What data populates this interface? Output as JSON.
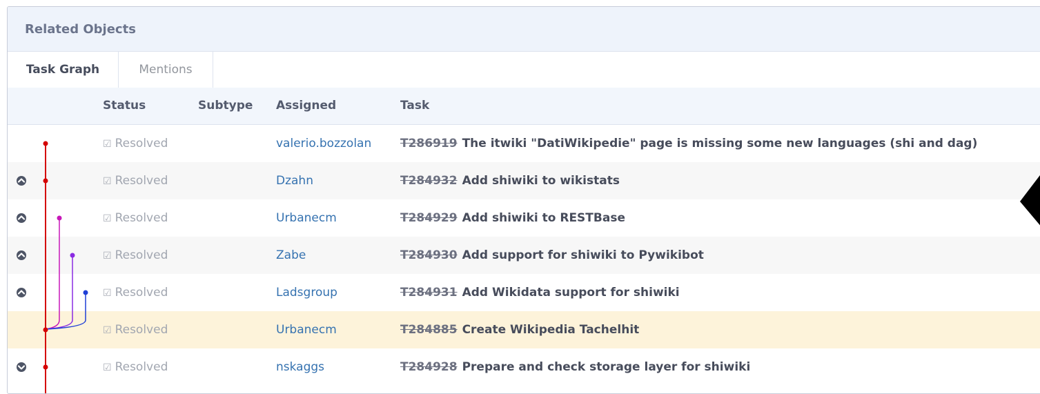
{
  "panel": {
    "title": "Related Objects"
  },
  "tabs": [
    {
      "label": "Task Graph",
      "active": true
    },
    {
      "label": "Mentions",
      "active": false
    }
  ],
  "columns": {
    "status": "Status",
    "subtype": "Subtype",
    "assigned": "Assigned",
    "task": "Task"
  },
  "rows": [
    {
      "toggle": "none",
      "status": "Resolved",
      "assigned": "valerio.bozzolan",
      "task_id": "T286919",
      "task_title": "The itwiki \"DatiWikipedie\" page is missing some new languages (shi and dag)"
    },
    {
      "toggle": "up",
      "status": "Resolved",
      "assigned": "Dzahn",
      "task_id": "T284932",
      "task_title": "Add shiwiki to wikistats"
    },
    {
      "toggle": "up",
      "status": "Resolved",
      "assigned": "Urbanecm",
      "task_id": "T284929",
      "task_title": "Add shiwiki to RESTBase"
    },
    {
      "toggle": "up",
      "status": "Resolved",
      "assigned": "Zabe",
      "task_id": "T284930",
      "task_title": "Add support for shiwiki to Pywikibot"
    },
    {
      "toggle": "up",
      "status": "Resolved",
      "assigned": "Ladsgroup",
      "task_id": "T284931",
      "task_title": "Add Wikidata support for shiwiki"
    },
    {
      "toggle": "none",
      "status": "Resolved",
      "assigned": "Urbanecm",
      "task_id": "T284885",
      "task_title": "Create Wikipedia Tachelhit"
    },
    {
      "toggle": "down",
      "status": "Resolved",
      "assigned": "nskaggs",
      "task_id": "T284928",
      "task_title": "Prepare and check storage layer for shiwiki"
    }
  ],
  "graph_colors": {
    "red": "#d40000",
    "magenta": "#c717b8",
    "purple": "#8a2be2",
    "blue": "#1f3fd6"
  }
}
